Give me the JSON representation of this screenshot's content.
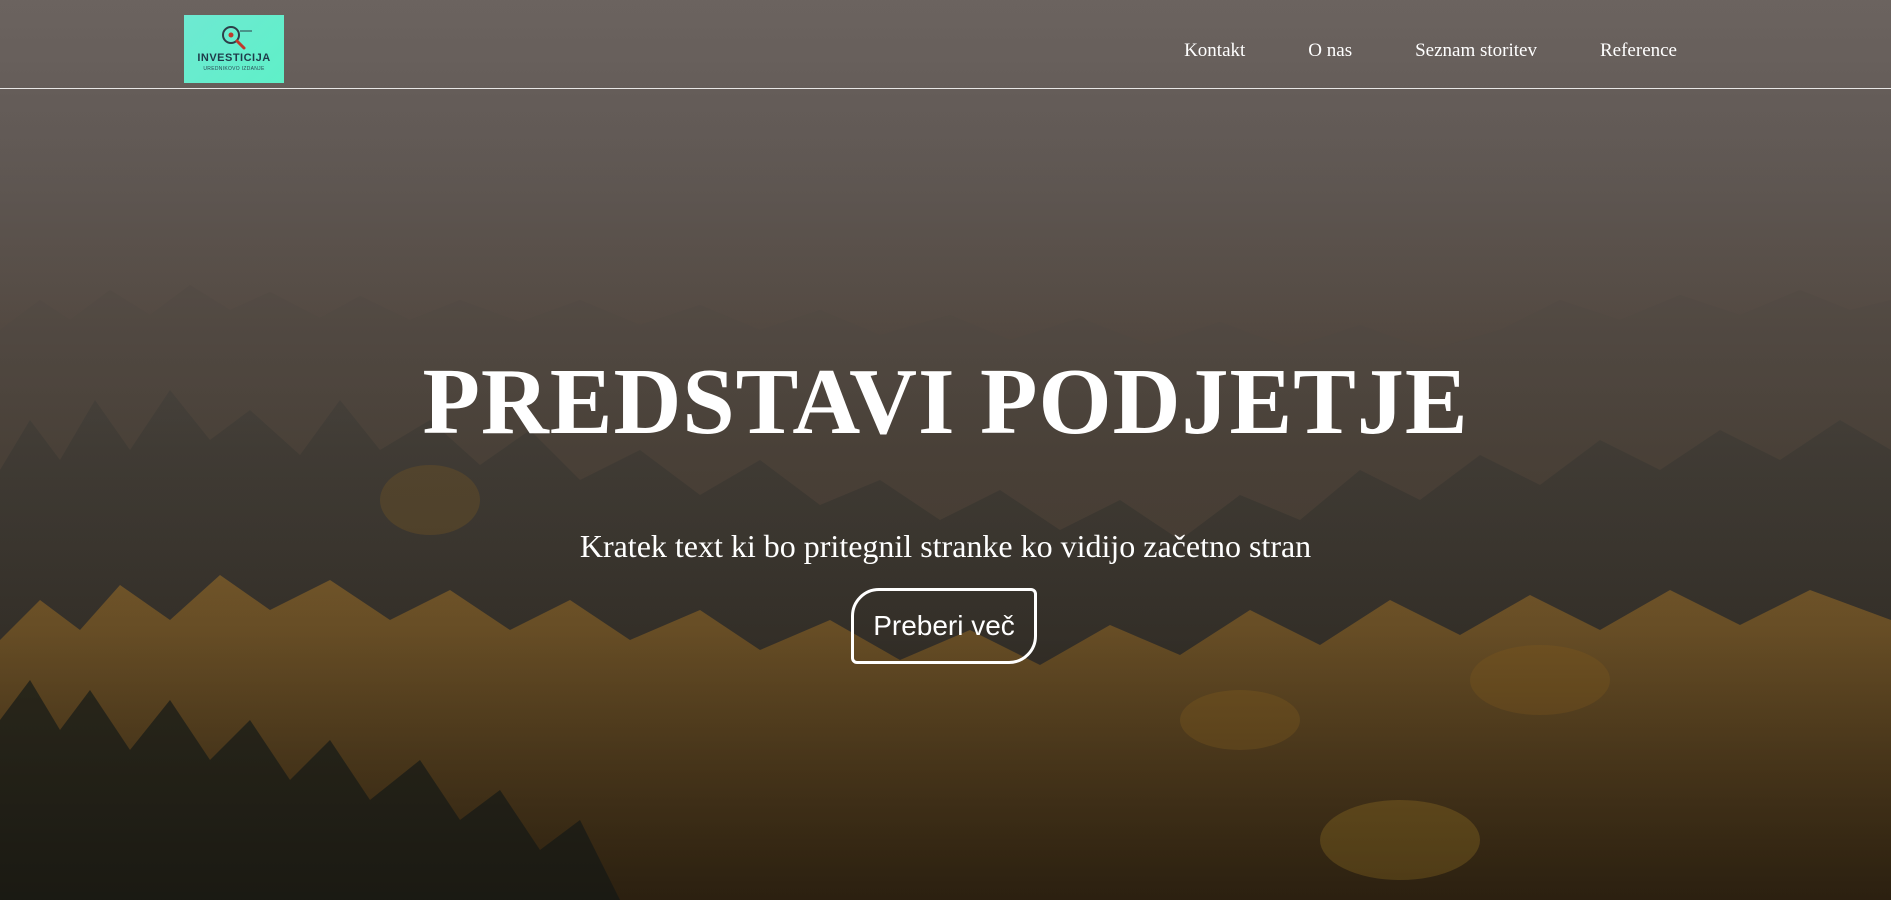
{
  "brand": {
    "logo_title": "INVESTICIJA",
    "logo_subtitle": "UREDNIKOVO IZDANJE",
    "logo_icon": "magnifier-icon",
    "logo_bg": "#6ee9d2"
  },
  "nav": {
    "items": [
      {
        "label": "Kontakt"
      },
      {
        "label": "O nas"
      },
      {
        "label": "Seznam storitev"
      },
      {
        "label": "Reference"
      }
    ]
  },
  "hero": {
    "title": "PREDSTAVI PODJETJE",
    "subtitle": "Kratek text ki bo pritegnil stranke ko vidijo začetno stran",
    "cta_label": "Preberi več"
  },
  "colors": {
    "text": "#ffffff",
    "divider": "#ffffff"
  }
}
